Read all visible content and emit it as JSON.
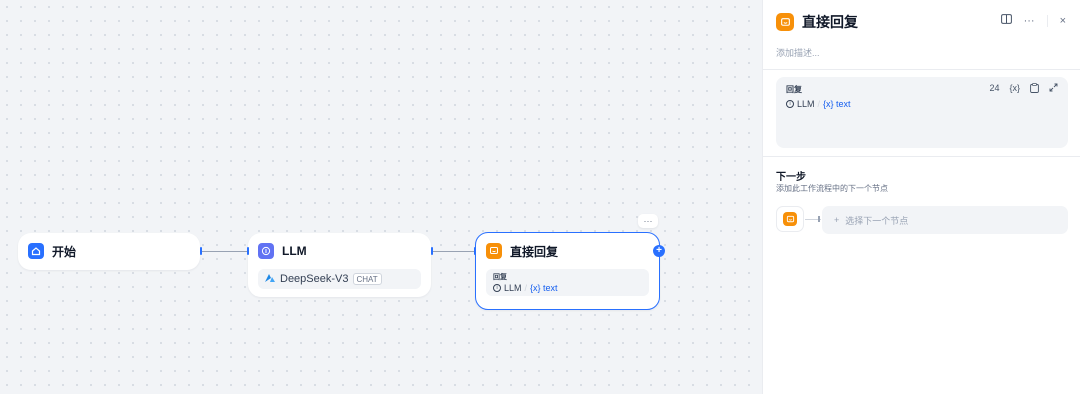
{
  "workflow": {
    "nodes": {
      "start": {
        "title": "开始",
        "icon": "home-icon"
      },
      "llm": {
        "title": "LLM",
        "icon": "llm-icon",
        "model": "DeepSeek-V3",
        "model_badge": "CHAT"
      },
      "answer": {
        "title": "直接回复",
        "icon": "reply-icon",
        "field_label": "回复",
        "var_source": "LLM",
        "var_sep": "/",
        "var_name": "{x} text",
        "more_label": "···",
        "add_label": "+"
      }
    }
  },
  "panel": {
    "title": "直接回复",
    "description_placeholder": "添加描述...",
    "tools": {
      "more": "···",
      "close": "×"
    },
    "answer": {
      "label": "回复",
      "count": "24",
      "var_insert": "{x}",
      "var_source": "LLM",
      "var_sep": "/",
      "var_name": "{x} text"
    },
    "next_step": {
      "title": "下一步",
      "subtitle": "添加此工作流程中的下一个节点",
      "select_label": "选择下一个节点",
      "select_prefix": "+"
    }
  },
  "colors": {
    "accent": "#2970ff",
    "llm_icon": "#6172f3",
    "answer_icon": "#f79009"
  }
}
